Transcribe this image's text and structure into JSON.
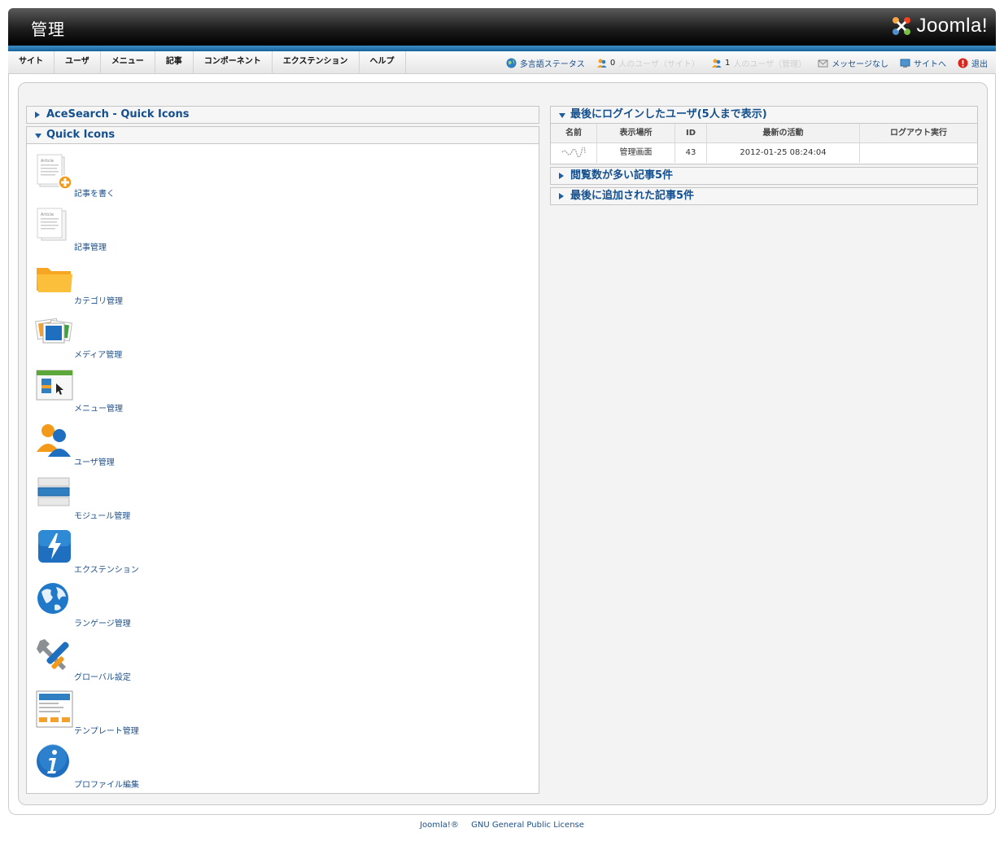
{
  "header": {
    "title": "管理",
    "logo_text": "Joomla!"
  },
  "menu": [
    "サイト",
    "ユーザ",
    "メニュー",
    "記事",
    "コンポーネント",
    "エクステンション",
    "ヘルプ"
  ],
  "status": {
    "multilang": "多言語ステータス",
    "users_site_count": "0",
    "users_site_text": "人のユーザ（サイト）",
    "users_admin_count": "1",
    "users_admin_text": "人のユーザ（管理）",
    "messages": "メッセージなし",
    "to_site": "サイトへ",
    "logout": "退出"
  },
  "panels_left": {
    "acesearch": "AceSearch - Quick Icons",
    "quick_icons": "Quick Icons"
  },
  "quick_icons": [
    {
      "label": "記事を書く",
      "icon": "add-article-icon"
    },
    {
      "label": "記事管理",
      "icon": "article-manager-icon"
    },
    {
      "label": "カテゴリ管理",
      "icon": "category-folder-icon"
    },
    {
      "label": "メディア管理",
      "icon": "media-icon"
    },
    {
      "label": "メニュー管理",
      "icon": "menu-manager-icon"
    },
    {
      "label": "ユーザ管理",
      "icon": "user-manager-icon"
    },
    {
      "label": "モジュール管理",
      "icon": "module-manager-icon"
    },
    {
      "label": "エクステンション",
      "icon": "extension-icon"
    },
    {
      "label": "ランゲージ管理",
      "icon": "language-globe-icon"
    },
    {
      "label": "グローバル設定",
      "icon": "global-config-icon"
    },
    {
      "label": "テンプレート管理",
      "icon": "template-manager-icon"
    },
    {
      "label": "プロファイル編集",
      "icon": "profile-info-icon"
    }
  ],
  "panels_right": {
    "last_login": "最後にログインしたユーザ(5人まで表示)",
    "popular": "閲覧数が多い記事5件",
    "recent": "最後に追加された記事5件"
  },
  "login_table": {
    "headers": [
      "名前",
      "表示場所",
      "ID",
      "最新の活動",
      "ログアウト実行"
    ],
    "rows": [
      [
        "",
        "管理画面",
        "43",
        "2012-01-25 08:24:04",
        ""
      ]
    ]
  },
  "footer": {
    "joomla": "Joomla!®",
    "license": "GNU General Public License"
  }
}
